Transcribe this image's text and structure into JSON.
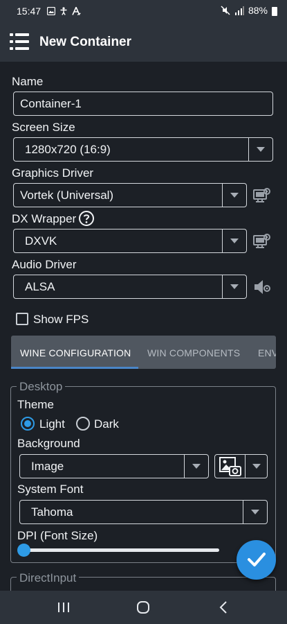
{
  "status_bar": {
    "time": "15:47",
    "battery_text": "88%",
    "left_icons": [
      "gallery-icon",
      "accessibility-icon",
      "font-a-icon"
    ],
    "right_icons": [
      "mute-icon",
      "signal-icon",
      "battery-icon"
    ]
  },
  "app_bar": {
    "title": "New Container",
    "menu_icon": "menu-list-icon"
  },
  "form": {
    "name_label": "Name",
    "name_value": "Container-1",
    "screen_size_label": "Screen Size",
    "screen_size_value": "1280x720 (16:9)",
    "graphics_driver_label": "Graphics Driver",
    "graphics_driver_value": "Vortek (Universal)",
    "dx_wrapper_label": "DX Wrapper",
    "dx_wrapper_value": "DXVK",
    "audio_driver_label": "Audio Driver",
    "audio_driver_value": "ALSA",
    "show_fps_label": "Show FPS",
    "show_fps_checked": false
  },
  "tabs": [
    {
      "label": "WINE CONFIGURATION",
      "active": true
    },
    {
      "label": "WIN COMPONENTS",
      "active": false
    },
    {
      "label": "ENV",
      "active": false
    }
  ],
  "desktop_group": {
    "legend": "Desktop",
    "theme_label": "Theme",
    "theme_options": [
      "Light",
      "Dark"
    ],
    "theme_selected": "Light",
    "background_label": "Background",
    "background_value": "Image",
    "system_font_label": "System Font",
    "system_font_value": "Tahoma",
    "dpi_label": "DPI (Font Size)",
    "dpi_slider_fraction": 0.0
  },
  "direct_input_group": {
    "legend": "DirectInput"
  },
  "colors": {
    "accent": "#2e9be6",
    "background": "#1c2026",
    "bar": "#2d333b",
    "tab_bar": "#505760"
  }
}
